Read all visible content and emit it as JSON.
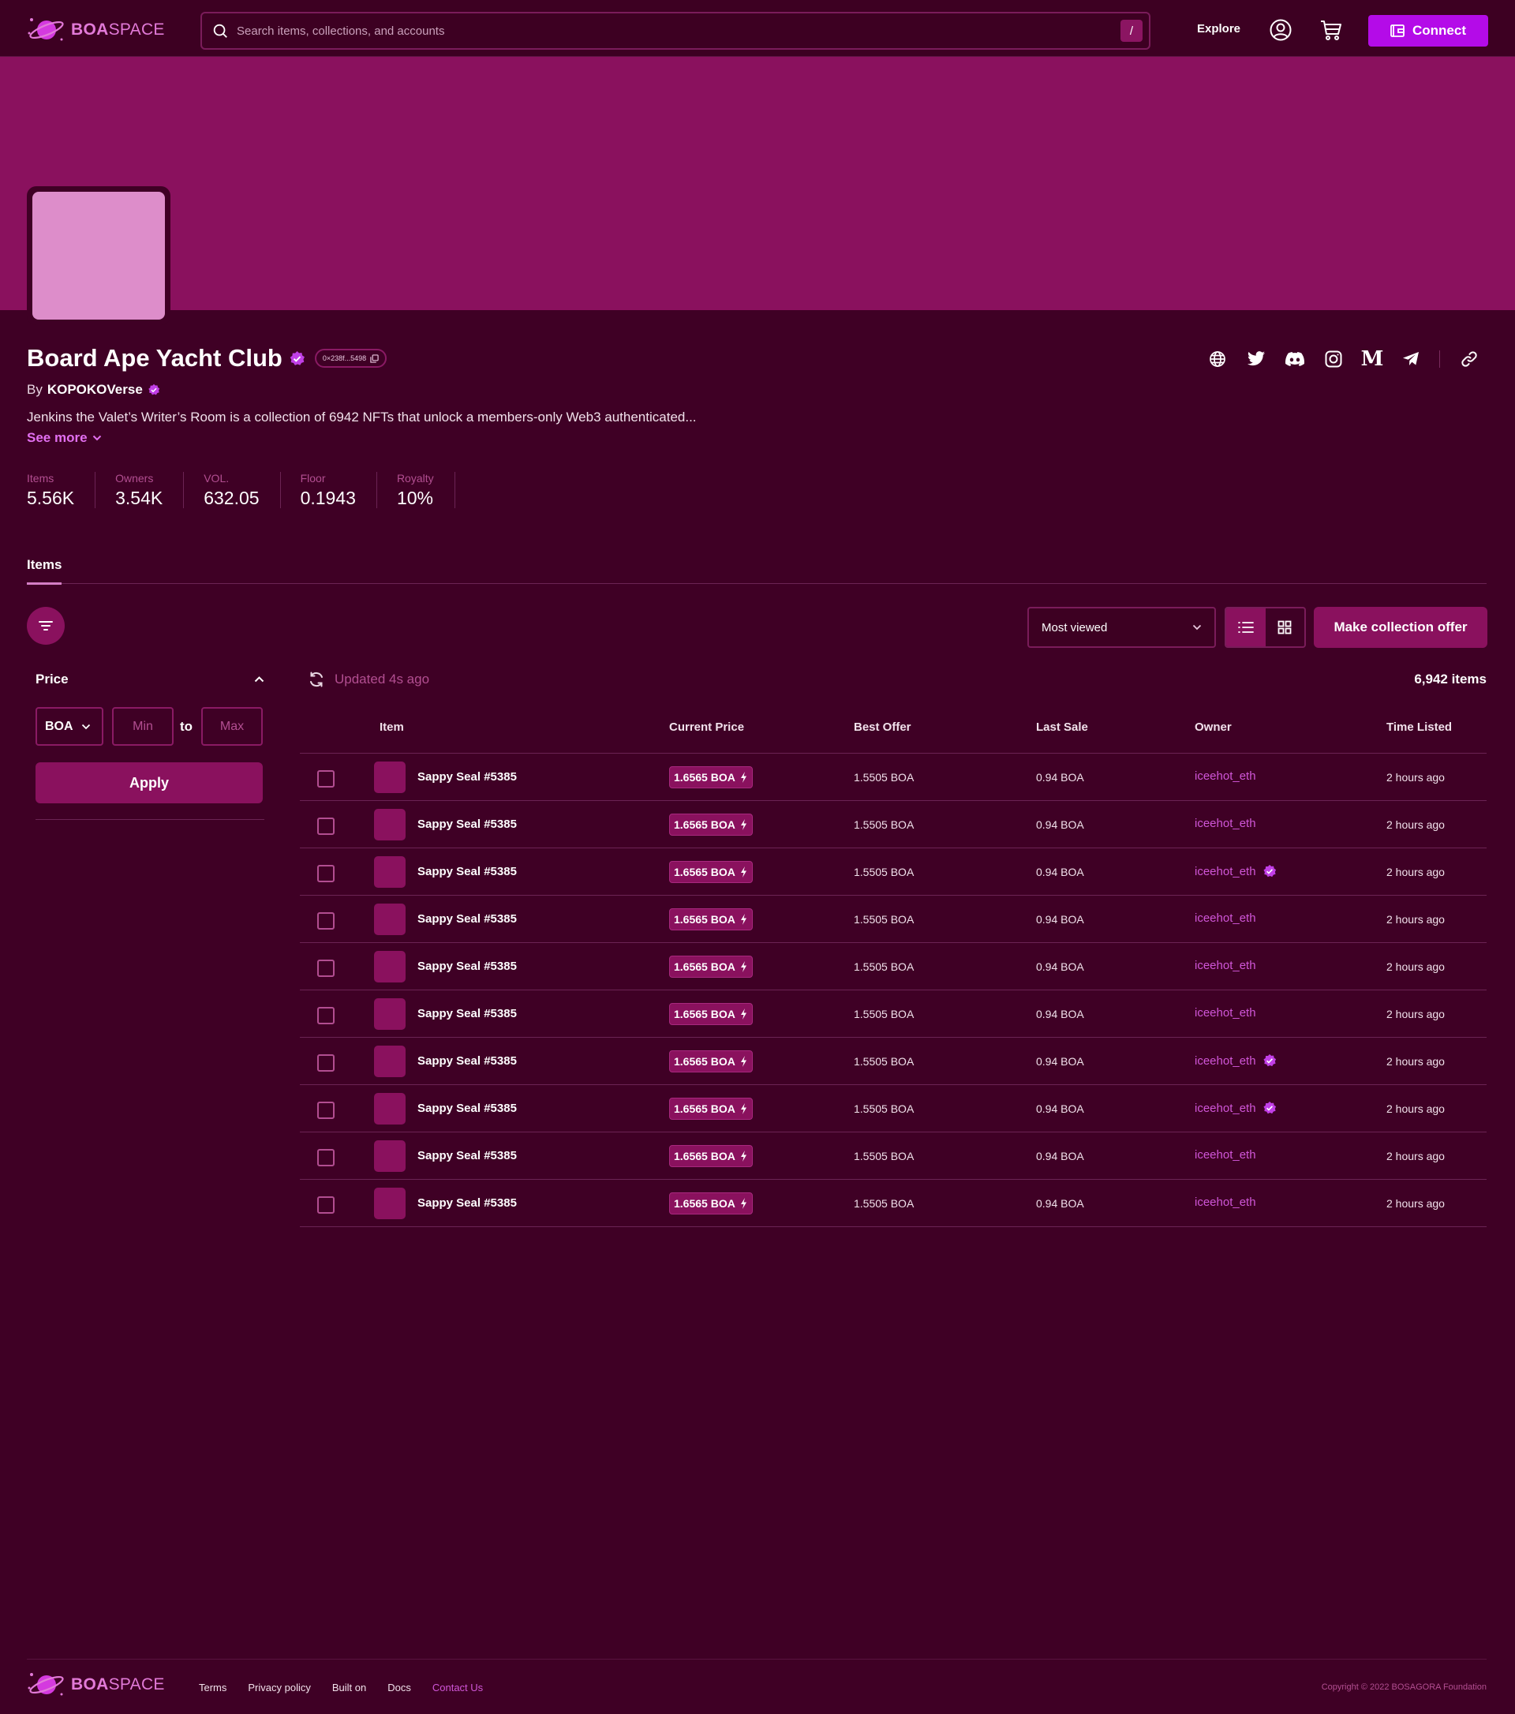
{
  "brand": {
    "name_bold": "BOA",
    "name_rest": "SPACE",
    "color": "#e27ad8"
  },
  "header": {
    "search_placeholder": "Search items, collections, and accounts",
    "search_shortcut": "/",
    "explore": "Explore",
    "connect": "Connect",
    "icons": [
      "search-icon",
      "user-icon",
      "cart-icon",
      "wallet-icon"
    ]
  },
  "collection": {
    "title": "Board Ape Yacht Club",
    "contract_short": "0×238f...5498",
    "by_prefix": "By",
    "creator": "KOPOKOVerse",
    "description": "Jenkins the Valet’s Writer’s Room is a collection of 6942 NFTs that unlock a members-only Web3 authenticated...",
    "see_more": "See more",
    "socials": [
      "globe-icon",
      "twitter-icon",
      "discord-icon",
      "instagram-icon",
      "medium-icon",
      "telegram-icon",
      "link-icon"
    ],
    "medium_glyph": "M"
  },
  "stats": [
    {
      "label": "Items",
      "value": "5.56K"
    },
    {
      "label": "Owners",
      "value": "3.54K"
    },
    {
      "label": "VOL.",
      "value": "632.05"
    },
    {
      "label": "Floor",
      "value": "0.1943"
    },
    {
      "label": "Royalty",
      "value": "10%"
    }
  ],
  "tabs": {
    "items": "Items"
  },
  "toolbar": {
    "sort_value": "Most viewed",
    "make_offer": "Make collection offer"
  },
  "filters": {
    "price_label": "Price",
    "currency": "BOA",
    "min_placeholder": "Min",
    "max_placeholder": "Max",
    "to": "to",
    "apply": "Apply"
  },
  "table": {
    "updated": "Updated 4s ago",
    "count": "6,942 items",
    "columns": [
      "Item",
      "Current Price",
      "Best Offer",
      "Last Sale",
      "Owner",
      "Time Listed"
    ],
    "rows": [
      {
        "name": "Sappy Seal #5385",
        "price": "1.6565 BOA",
        "best_offer": "1.5505 BOA",
        "last_sale": "0.94 BOA",
        "owner": "iceehot_eth",
        "verified": false,
        "time": "2 hours ago"
      },
      {
        "name": "Sappy Seal #5385",
        "price": "1.6565 BOA",
        "best_offer": "1.5505 BOA",
        "last_sale": "0.94 BOA",
        "owner": "iceehot_eth",
        "verified": false,
        "time": "2 hours ago"
      },
      {
        "name": "Sappy Seal #5385",
        "price": "1.6565 BOA",
        "best_offer": "1.5505 BOA",
        "last_sale": "0.94 BOA",
        "owner": "iceehot_eth",
        "verified": true,
        "time": "2 hours ago"
      },
      {
        "name": "Sappy Seal #5385",
        "price": "1.6565 BOA",
        "best_offer": "1.5505 BOA",
        "last_sale": "0.94 BOA",
        "owner": "iceehot_eth",
        "verified": false,
        "time": "2 hours ago"
      },
      {
        "name": "Sappy Seal #5385",
        "price": "1.6565 BOA",
        "best_offer": "1.5505 BOA",
        "last_sale": "0.94 BOA",
        "owner": "iceehot_eth",
        "verified": false,
        "time": "2 hours ago"
      },
      {
        "name": "Sappy Seal #5385",
        "price": "1.6565 BOA",
        "best_offer": "1.5505 BOA",
        "last_sale": "0.94 BOA",
        "owner": "iceehot_eth",
        "verified": false,
        "time": "2 hours ago"
      },
      {
        "name": "Sappy Seal #5385",
        "price": "1.6565 BOA",
        "best_offer": "1.5505 BOA",
        "last_sale": "0.94 BOA",
        "owner": "iceehot_eth",
        "verified": true,
        "time": "2 hours ago"
      },
      {
        "name": "Sappy Seal #5385",
        "price": "1.6565 BOA",
        "best_offer": "1.5505 BOA",
        "last_sale": "0.94 BOA",
        "owner": "iceehot_eth",
        "verified": true,
        "time": "2 hours ago"
      },
      {
        "name": "Sappy Seal #5385",
        "price": "1.6565 BOA",
        "best_offer": "1.5505 BOA",
        "last_sale": "0.94 BOA",
        "owner": "iceehot_eth",
        "verified": false,
        "time": "2 hours ago"
      },
      {
        "name": "Sappy Seal #5385",
        "price": "1.6565 BOA",
        "best_offer": "1.5505 BOA",
        "last_sale": "0.94 BOA",
        "owner": "iceehot_eth",
        "verified": false,
        "time": "2 hours ago"
      }
    ]
  },
  "footer": {
    "links": [
      "Terms",
      "Privacy policy",
      "Built on",
      "Docs",
      "Contact Us"
    ],
    "copyright": "Copyright © 2022 BOSAGORA Foundation"
  },
  "colors": {
    "background": "#3f0025",
    "banner": "#8a115e",
    "accent": "#b40be8",
    "link": "#d056d8",
    "verified": "#c13fe6"
  }
}
